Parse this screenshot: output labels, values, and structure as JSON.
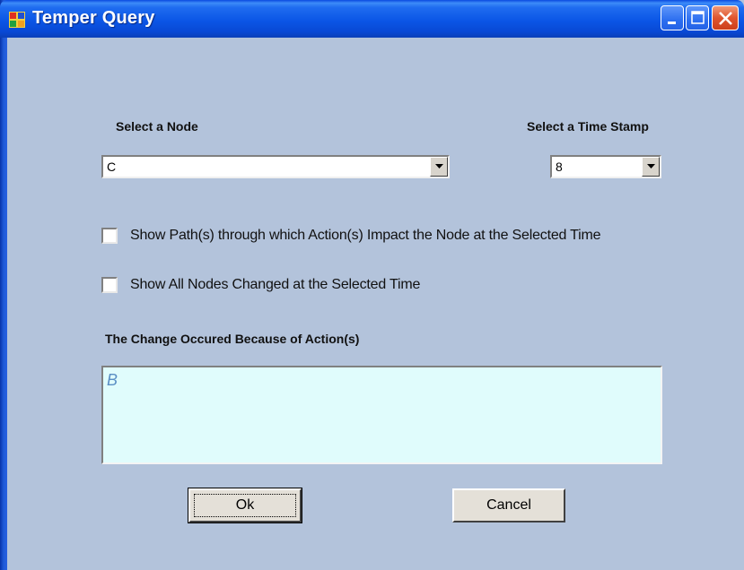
{
  "window": {
    "title": "Temper Query"
  },
  "form": {
    "node_label": "Select a Node",
    "node_value": "C",
    "time_label": "Select a Time Stamp",
    "time_value": "8",
    "show_path_label": "Show Path(s) through which Action(s) Impact the Node at the Selected Time",
    "show_path_checked": false,
    "show_all_label": "Show All Nodes Changed at the Selected Time",
    "show_all_checked": false,
    "change_label": "The Change Occured Because of Action(s)",
    "change_value": "B",
    "ok_label": "Ok",
    "cancel_label": "Cancel"
  },
  "colors": {
    "window_bg": "#b3c3db",
    "titlebar": "#0b56e6",
    "result_bg": "#e0fcfc",
    "close_button": "#e0552e"
  }
}
